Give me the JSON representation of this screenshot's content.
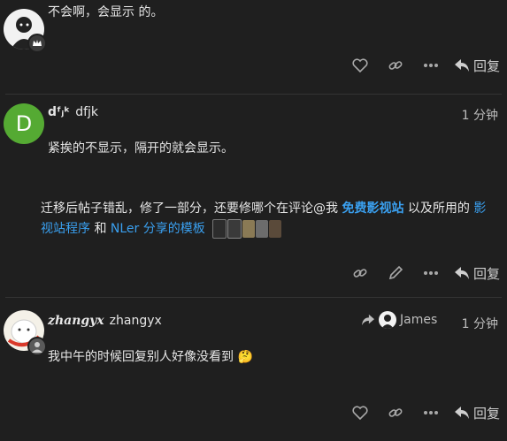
{
  "post1": {
    "text": "不会啊，会显示 的。",
    "reply_label": "回复"
  },
  "post2": {
    "avatar_letter": "D",
    "avatar_color": "#55aa33",
    "display_name": "dᶠⱼᵏ",
    "username": "dfjk",
    "time": "1 分钟",
    "paragraph1": "紧挨的不显示，隔开的就会显示。",
    "paragraph2_part1": "迁移后帖子错乱，修了一部分，还要修哪个在评论@我 ",
    "link1": "免费影视站",
    "paragraph2_part2": " 以及所用的 ",
    "link2a": "影",
    "link2b": "视站程序",
    "paragraph2_part3": " 和 ",
    "link3": "NLer 分享的模板",
    "reply_label": "回复"
  },
  "post3": {
    "display_name": "zhangyx",
    "username": "zhangyx",
    "reply_to": "James",
    "time": "1 分钟",
    "text": "我中午的时候回复别人好像没看到 🤔",
    "reply_label": "回复"
  },
  "colors": {
    "link": "#3aa0f0",
    "background": "#1f1f1f"
  }
}
